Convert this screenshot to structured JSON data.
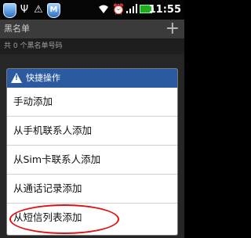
{
  "status_bar": {
    "time": "11:55",
    "icons": [
      "usb-icon",
      "shield-icon",
      "wifi-icon",
      "signal-icon",
      "battery-icon"
    ],
    "shield_glyph": "M"
  },
  "app_bar": {
    "title": "黑名单",
    "add_glyph": "+"
  },
  "sub_bar": {
    "text": "共 0 个黑名单号码"
  },
  "dialog": {
    "title": "快捷操作",
    "warning_glyph": "!",
    "items": [
      {
        "label": "手动添加"
      },
      {
        "label": "从手机联系人添加"
      },
      {
        "label": "从Sim卡联系人添加"
      },
      {
        "label": "从通话记录添加"
      },
      {
        "label": "从短信列表添加"
      }
    ]
  },
  "colors": {
    "header_blue": "#2b5aa0",
    "highlight_red": "#e01010"
  }
}
